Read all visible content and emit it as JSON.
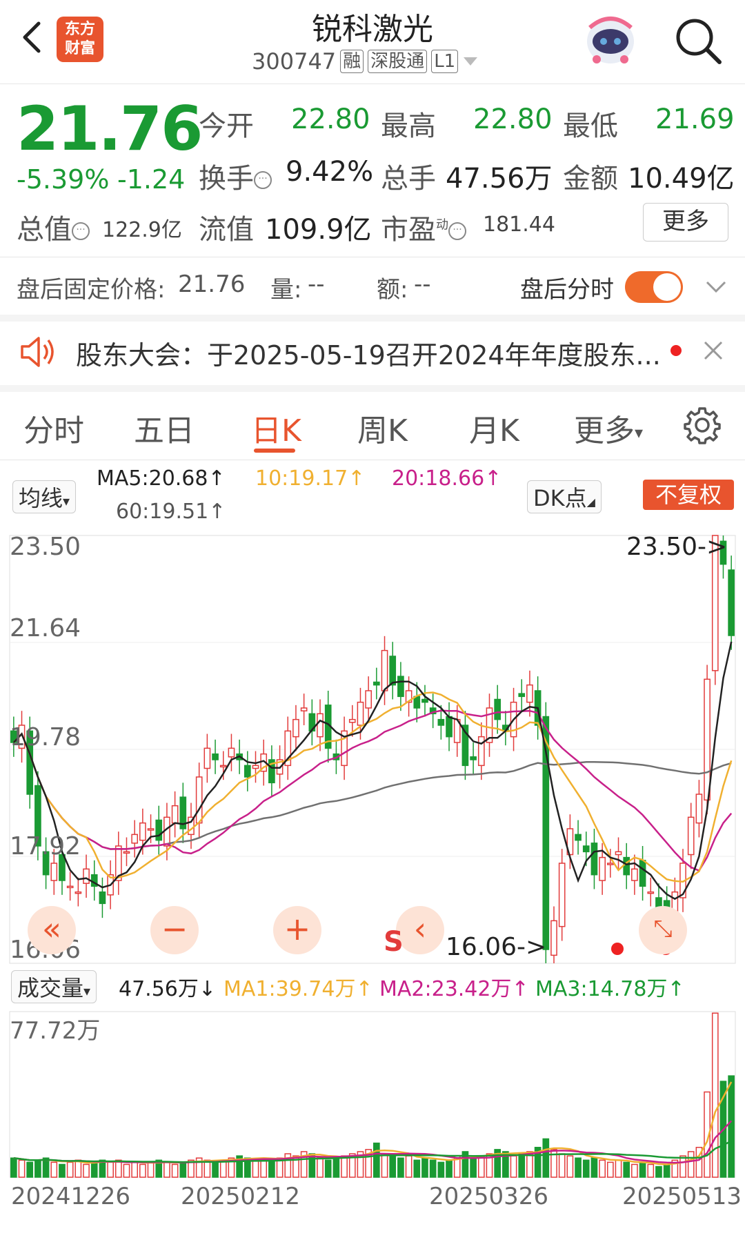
{
  "header": {
    "logo_text": "东方财富",
    "logo_line1": "东方",
    "logo_line2": "财富",
    "stock_name": "锐科激光",
    "stock_code": "300747",
    "tags": [
      "融",
      "深股通",
      "L1"
    ]
  },
  "quote": {
    "price": "21.76",
    "change_pct": "-5.39%",
    "change_amt": "-1.24",
    "open_label": "今开",
    "open": "22.80",
    "high_label": "最高",
    "high": "22.80",
    "low_label": "最低",
    "low": "21.69",
    "turnover_label": "换手",
    "turnover": "9.42%",
    "volume_label": "总手",
    "volume": "47.56万",
    "amount_label": "金额",
    "amount": "10.49亿",
    "mktcap_label": "总值",
    "mktcap": "122.9亿",
    "float_label": "流值",
    "float": "109.9亿",
    "pe_label": "市盈",
    "pe_sup": "动",
    "pe": "181.44",
    "more_label": "更多"
  },
  "after_hours": {
    "fixed_price_label": "盘后固定价格:",
    "fixed_price": "21.76",
    "vol_label": "量:",
    "vol": "--",
    "amt_label": "额:",
    "amt": "--",
    "intraday_label": "盘后分时",
    "toggle_on": true
  },
  "notice": {
    "text": "股东大会：于2025-05-19召开2024年年度股东..."
  },
  "tabs": [
    {
      "label": "分时"
    },
    {
      "label": "五日"
    },
    {
      "label": "日K"
    },
    {
      "label": "周K"
    },
    {
      "label": "月K"
    },
    {
      "label": "更多"
    }
  ],
  "ma_bar": {
    "selector": "均线",
    "ma5": "MA5:20.68↑",
    "ma10": "10:19.17↑",
    "ma20": "20:18.66↑",
    "ma60": "60:19.51↑",
    "dk_label": "DK点",
    "fq_label": "不复权"
  },
  "kline": {
    "axis_labels": [
      "23.50",
      "21.64",
      "19.78",
      "17.92",
      "16.06"
    ],
    "max_marker": "23.50->",
    "min_marker": "16.06->",
    "s_marker": "S"
  },
  "vol_bar": {
    "selector": "成交量",
    "vol": "47.56万↓",
    "ma1": "MA1:39.74万↑",
    "ma2": "MA2:23.42万↑",
    "ma3": "MA3:14.78万↑",
    "axis_top": "77.72万"
  },
  "dates": [
    "20241226",
    "20250212",
    "20250326",
    "20250513"
  ],
  "colors": {
    "up": "#e23b3b",
    "down": "#1a9a33",
    "accent": "#e8542e",
    "ma5": "#222222",
    "ma10": "#f0b030",
    "ma20": "#c8208a",
    "ma60": "#707070"
  },
  "chart_data": {
    "type": "candlestick",
    "price_axis": {
      "min": 16.06,
      "max": 23.5
    },
    "closes": [
      19.9,
      20.2,
      19.0,
      18.1,
      17.6,
      17.8,
      17.5,
      17.4,
      17.3,
      17.7,
      17.4,
      17.1,
      17.6,
      18.1,
      18.0,
      18.3,
      18.5,
      18.4,
      18.2,
      18.6,
      18.8,
      18.4,
      18.6,
      19.3,
      19.8,
      19.6,
      19.5,
      19.8,
      19.6,
      19.3,
      19.5,
      19.7,
      19.2,
      19.6,
      20.1,
      20.3,
      20.5,
      20.1,
      20.4,
      19.8,
      19.6,
      20.1,
      20.3,
      20.6,
      20.8,
      20.9,
      21.5,
      20.9,
      20.7,
      20.8,
      20.5,
      20.6,
      20.4,
      20.2,
      20.0,
      20.3,
      19.5,
      19.6,
      20.0,
      20.5,
      20.3,
      20.1,
      20.6,
      20.7,
      20.9,
      20.2,
      16.3,
      16.8,
      17.8,
      18.4,
      18.2,
      18.0,
      17.6,
      17.9,
      17.8,
      18.0,
      17.6,
      17.7,
      17.4,
      17.3,
      17.0,
      16.9,
      17.3,
      17.8,
      18.6,
      19.0,
      21.0,
      23.5,
      23.0,
      21.76
    ],
    "volumes": [
      9,
      8,
      7,
      8,
      9,
      7,
      6,
      7,
      8,
      6,
      7,
      8,
      7,
      8,
      6,
      7,
      6,
      7,
      8,
      7,
      6,
      7,
      8,
      9,
      8,
      7,
      8,
      9,
      10,
      9,
      8,
      9,
      8,
      9,
      11,
      10,
      12,
      11,
      9,
      8,
      9,
      10,
      11,
      12,
      13,
      16,
      11,
      10,
      9,
      10,
      8,
      9,
      8,
      7,
      8,
      10,
      12,
      9,
      10,
      11,
      13,
      12,
      10,
      11,
      12,
      14,
      18,
      13,
      11,
      10,
      9,
      8,
      9,
      8,
      7,
      8,
      7,
      6,
      7,
      6,
      5,
      6,
      8,
      10,
      12,
      14,
      40,
      77,
      45,
      47.56
    ],
    "vol_axis_max": 77.72
  }
}
